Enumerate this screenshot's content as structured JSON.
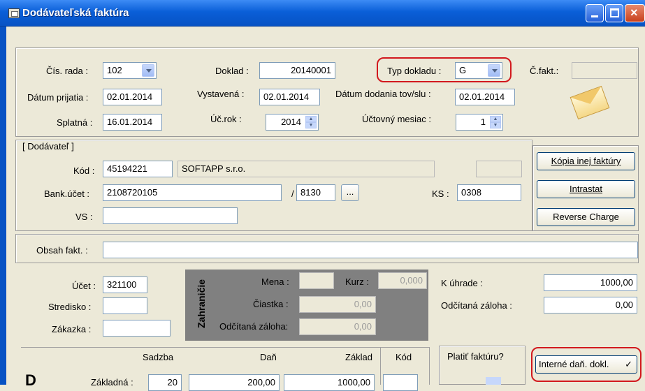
{
  "window": {
    "title": "Dodávateľská faktúra"
  },
  "header": {
    "cis_rada_label": "Čís. rada :",
    "cis_rada_value": "102",
    "doklad_label": "Doklad :",
    "doklad_value": "20140001",
    "typ_dokladu_label": "Typ dokladu :",
    "typ_dokladu_value": "G",
    "c_fakt_label": "Č.fakt.:",
    "c_fakt_value": "",
    "datum_prijatia_label": "Dátum prijatia :",
    "datum_prijatia_value": "02.01.2014",
    "vystavena_label": "Vystavená :",
    "vystavena_value": "02.01.2014",
    "datum_dodania_label": "Dátum dodania tov/slu :",
    "datum_dodania_value": "02.01.2014",
    "splatna_label": "Splatná :",
    "splatna_value": "16.01.2014",
    "uc_rok_label": "Úč.rok :",
    "uc_rok_value": "2014",
    "uctovny_mesiac_label": "Účtovný mesiac :",
    "uctovny_mesiac_value": "1"
  },
  "supplier": {
    "group_label": "[ Dodávateľ ]",
    "kod_label": "Kód :",
    "kod_value": "45194221",
    "name_value": "SOFTAPP s.r.o.",
    "extra_value": "",
    "bank_label": "Bank.účet :",
    "bank_value": "2108720105",
    "slash": "/",
    "bank_code": "8130",
    "browse": "...",
    "ks_label": "KS :",
    "ks_value": "0308",
    "vs_label": "VS :",
    "vs_value": ""
  },
  "side_buttons": {
    "kopia": "Kópia inej faktúry",
    "intrastat": "Intrastat",
    "reverse": "Reverse Charge"
  },
  "obsah": {
    "label": "Obsah fakt. :",
    "value": ""
  },
  "accounting": {
    "ucet_label": "Účet :",
    "ucet_value": "321100",
    "stredisko_label": "Stredisko :",
    "stredisko_value": "",
    "zakazka_label": "Zákazka :",
    "zakazka_value": ""
  },
  "foreign": {
    "title": "Zahraničie",
    "mena_label": "Mena :",
    "mena_value": "",
    "kurz_label": "Kurz :",
    "kurz_value": "0,000",
    "ciastka_label": "Čiastka :",
    "ciastka_value": "0,00",
    "zaloha_label": "Odčítaná záloha:",
    "zaloha_value": "0,00"
  },
  "payment": {
    "k_uhrade_label": "K úhrade :",
    "k_uhrade_value": "1000,00",
    "odcitana_label": "Odčítaná záloha :",
    "odcitana_value": "0,00"
  },
  "tax_table": {
    "col_sadzba": "Sadzba",
    "col_dan": "Daň",
    "col_zaklad": "Základ",
    "col_kod": "Kód",
    "row_label": "Základná :",
    "sadzba": "20",
    "dan": "200,00",
    "zaklad": "1000,00",
    "kod": "",
    "big_letter": "D"
  },
  "platit": {
    "label": "Platiť faktúru?"
  },
  "interne": {
    "label": "Interné daň. dokl.",
    "check": "✓"
  }
}
